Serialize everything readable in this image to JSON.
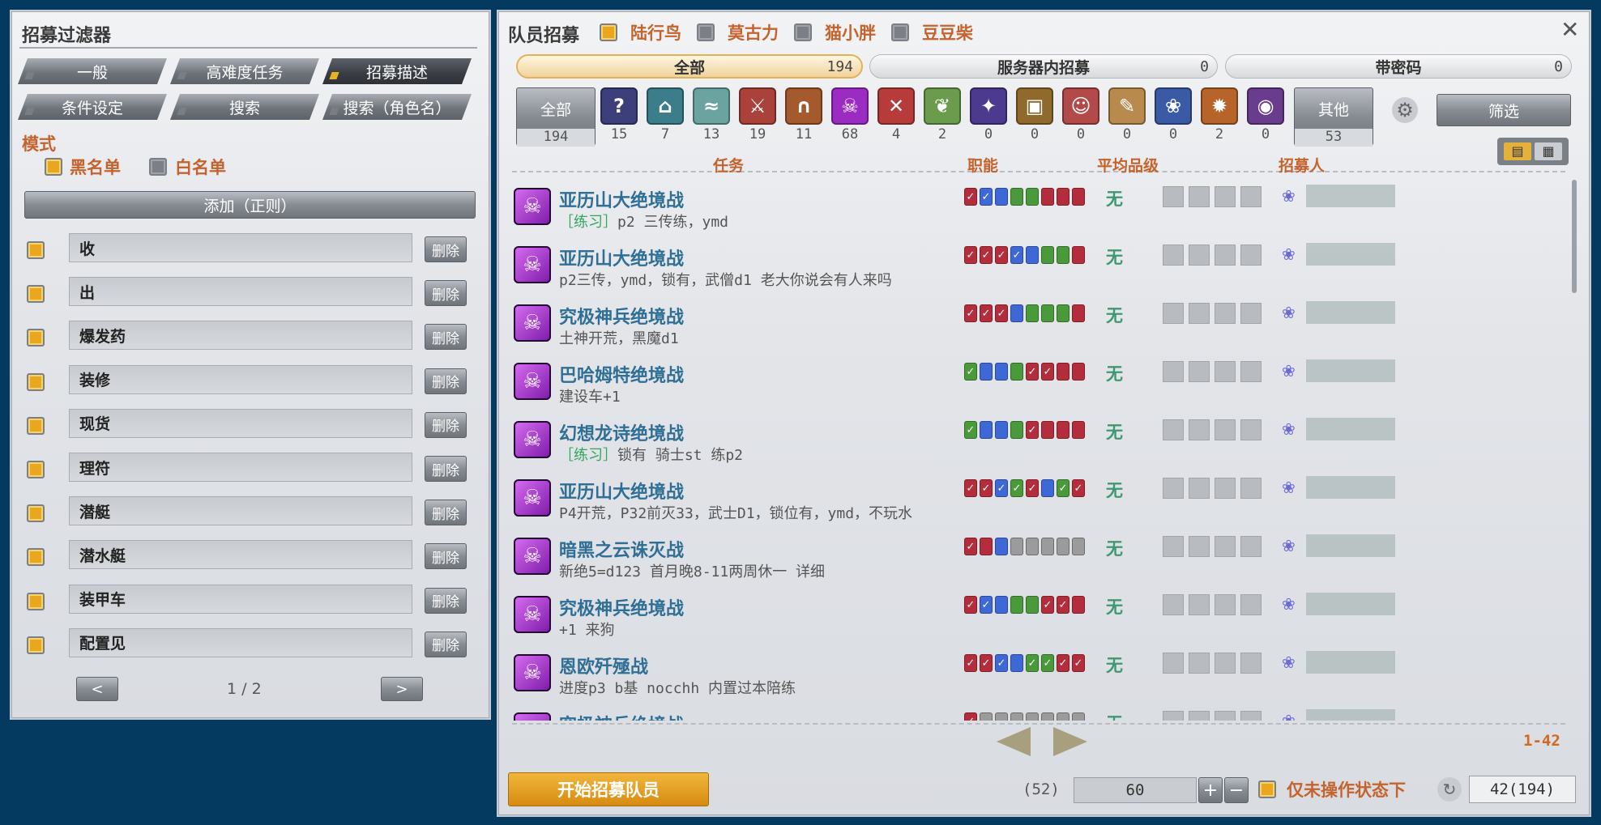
{
  "filter_window": {
    "title": "招募过滤器",
    "tabs": [
      {
        "label": "一般",
        "active": false
      },
      {
        "label": "高难度任务",
        "active": false
      },
      {
        "label": "招募描述",
        "active": true
      },
      {
        "label": "条件设定",
        "active": false
      },
      {
        "label": "搜索",
        "active": false
      },
      {
        "label": "搜索（角色名）",
        "active": false
      }
    ],
    "mode_label": "模式",
    "blacklist_label": "黑名单",
    "whitelist_label": "白名单",
    "add_button": "添加（正则）",
    "rules": [
      "收",
      "出",
      "爆发药",
      "装修",
      "现货",
      "理符",
      "潜艇",
      "潜水艇",
      "装甲车",
      "配置见"
    ],
    "delete_label": "删除",
    "pager": {
      "prev": "<",
      "next": ">",
      "text": "1 / 2"
    }
  },
  "recruit_window": {
    "title": "队员招募",
    "chocobos": [
      {
        "label": "陆行鸟",
        "checked": true
      },
      {
        "label": "莫古力",
        "checked": false
      },
      {
        "label": "猫小胖",
        "checked": false
      },
      {
        "label": "豆豆柴",
        "checked": false
      }
    ],
    "close_icon": "close-icon",
    "top_tabs": [
      {
        "label": "全部",
        "count": "194",
        "active": true
      },
      {
        "label": "服务器内招募",
        "count": "0",
        "active": false
      },
      {
        "label": "带密码",
        "count": "0",
        "active": false
      }
    ],
    "cat_all": {
      "label": "全部",
      "count": "194"
    },
    "categories": [
      {
        "icon": "?",
        "count": "15",
        "color": "#3d3f7a"
      },
      {
        "icon": "⌂",
        "count": "7",
        "color": "#3b7d8a"
      },
      {
        "icon": "≈",
        "count": "13",
        "color": "#6aa3a0"
      },
      {
        "icon": "⚔",
        "count": "19",
        "color": "#a9423a"
      },
      {
        "icon": "∩",
        "count": "11",
        "color": "#a55a2e"
      },
      {
        "icon": "☠",
        "count": "68",
        "color": "#9b2cc2"
      },
      {
        "icon": "✕",
        "count": "4",
        "color": "#b73b3b"
      },
      {
        "icon": "❦",
        "count": "2",
        "color": "#6b9c4e"
      },
      {
        "icon": "✦",
        "count": "0",
        "color": "#4b3a8e"
      },
      {
        "icon": "▣",
        "count": "0",
        "color": "#8f6a2c"
      },
      {
        "icon": "☺",
        "count": "0",
        "color": "#b34a4a"
      },
      {
        "icon": "✎",
        "count": "0",
        "color": "#b98a4e"
      },
      {
        "icon": "❀",
        "count": "0",
        "color": "#3b5aa6"
      },
      {
        "icon": "✹",
        "count": "2",
        "color": "#b6642a"
      },
      {
        "icon": "◉",
        "count": "0",
        "color": "#6a3c8e"
      }
    ],
    "cat_other": {
      "label": "其他",
      "count": "53"
    },
    "gear_icon": "gear-icon",
    "filter_button": "筛选",
    "columns": {
      "duty": "任务",
      "jobs": "职能",
      "level": "平均品级",
      "recruiter": "招募人"
    },
    "listings": [
      {
        "name": "亚历山大绝境战",
        "tag": "［练习］",
        "desc": "p2 三传练，ymd",
        "jobs": [
          "rv",
          "bv",
          "b",
          "g",
          "g",
          "r",
          "r",
          "r"
        ],
        "level": "无"
      },
      {
        "name": "亚历山大绝境战",
        "tag": "",
        "desc": "p2三传，ymd，锁有，武僧d1 老大你说会有人来吗",
        "jobs": [
          "rv",
          "rv",
          "rv",
          "bv",
          "b",
          "g",
          "g",
          "r"
        ],
        "level": "无"
      },
      {
        "name": "究极神兵绝境战",
        "tag": "",
        "desc": "土神开荒，黑魔d1",
        "jobs": [
          "rv",
          "rv",
          "rv",
          "b",
          "g",
          "g",
          "g",
          "r"
        ],
        "level": "无"
      },
      {
        "name": "巴哈姆特绝境战",
        "tag": "",
        "desc": "建设车+1",
        "jobs": [
          "gv",
          "b",
          "b",
          "g",
          "rv",
          "rv",
          "r",
          "r"
        ],
        "level": "无"
      },
      {
        "name": "幻想龙诗绝境战",
        "tag": "［练习］",
        "desc": "锁有 骑士st 练p2",
        "jobs": [
          "gv",
          "b",
          "b",
          "g",
          "rv",
          "r",
          "r",
          "r"
        ],
        "level": "无"
      },
      {
        "name": "亚历山大绝境战",
        "tag": "",
        "desc": "P4开荒，P32前灭33，武士D1，锁位有，ymd，不玩水",
        "jobs": [
          "rv",
          "rv",
          "bv",
          "gv",
          "rv",
          "b",
          "gv",
          "rv"
        ],
        "level": "无"
      },
      {
        "name": "暗黑之云诛灭战",
        "tag": "",
        "desc": "新绝5=d123 首月晚8-11两周休一 详细",
        "jobs": [
          "rv",
          "r",
          "b",
          "x",
          "x",
          "x",
          "x",
          "x"
        ],
        "level": "无"
      },
      {
        "name": "究极神兵绝境战",
        "tag": "",
        "desc": "+1 来狗",
        "jobs": [
          "rv",
          "bv",
          "b",
          "g",
          "g",
          "rv",
          "rv",
          "r"
        ],
        "level": "无"
      },
      {
        "name": "恩欧歼殛战",
        "tag": "",
        "desc": "进度p3 b基 nocchh 内置过本陪练",
        "jobs": [
          "rv",
          "rv",
          "bv",
          "b",
          "gv",
          "gv",
          "rv",
          "rv"
        ],
        "level": "无"
      },
      {
        "name": "究极神兵绝境战",
        "tag": "",
        "desc": "",
        "jobs": [
          "rv",
          "x",
          "x",
          "x",
          "x",
          "x",
          "x",
          "x"
        ],
        "level": "无"
      }
    ],
    "range_label": "1-42",
    "start_button": "开始招募队员",
    "count_hint": "(52)",
    "count_value": "60",
    "plus": "+",
    "minus": "−",
    "idle_only_label": "仅未操作状态下",
    "total": "42(194)"
  }
}
